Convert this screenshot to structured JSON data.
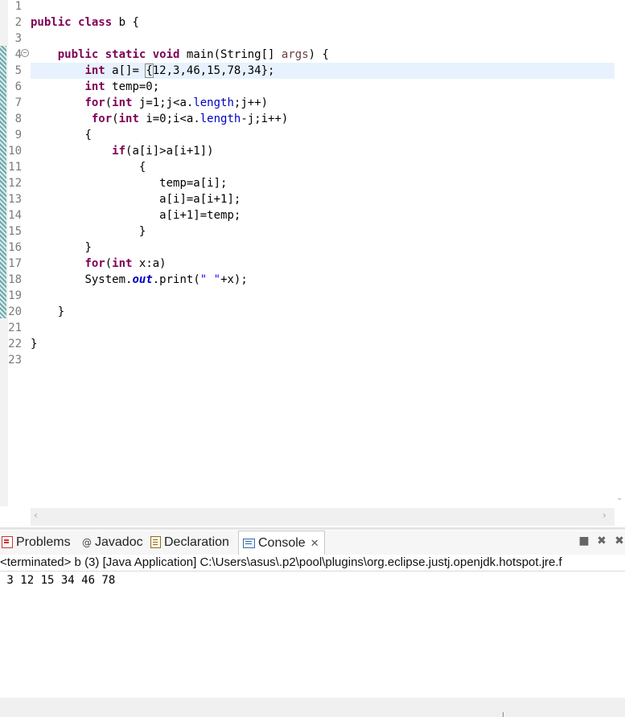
{
  "editor": {
    "line_numbers": [
      "1",
      "2",
      "3",
      "4",
      "5",
      "6",
      "7",
      "8",
      "9",
      "10",
      "11",
      "12",
      "13",
      "14",
      "15",
      "16",
      "17",
      "18",
      "19",
      "20",
      "21",
      "22",
      "23"
    ],
    "code": {
      "l2_kw1": "public",
      "l2_kw2": "class",
      "l2_rest": " b {",
      "l4_kw1": "public",
      "l4_kw2": "static",
      "l4_kw3": "void",
      "l4_t1": " main(String[] ",
      "l4_param": "args",
      "l4_t2": ") {",
      "l5_kw": "int",
      "l5_t1": " a[]= ",
      "l5_brace": "{",
      "l5_t2": "12,3,46,15,78,34};",
      "l6_kw": "int",
      "l6_t1": " temp=0;",
      "l7_kw1": "for",
      "l7_t1": "(",
      "l7_kw2": "int",
      "l7_t2": " j=1;j<a.",
      "l7_fld": "length",
      "l7_t3": ";j++)",
      "l8_kw1": "for",
      "l8_t1": "(",
      "l8_kw2": "int",
      "l8_t2": " i=0;i<a.",
      "l8_fld": "length",
      "l8_t3": "-j;i++)",
      "l9_t": "{",
      "l10_kw": "if",
      "l10_t": "(a[i]>a[i+1])",
      "l11_t": "{",
      "l12_t": "temp=a[i];",
      "l13_t": "a[i]=a[i+1];",
      "l14_t": "a[i+1]=temp;",
      "l15_t": "}",
      "l16_t": "}",
      "l17_kw1": "for",
      "l17_t1": "(",
      "l17_kw2": "int",
      "l17_t2": " x:a)",
      "l18_t1": "System.",
      "l18_sfld": "out",
      "l18_t2": ".print(",
      "l18_str": "\" \"",
      "l18_t3": "+x);",
      "l20_t": "}",
      "l22_t": "}"
    }
  },
  "bottom_panel": {
    "tabs": {
      "problems": "Problems",
      "javadoc": "Javadoc",
      "declaration": "Declaration",
      "console": "Console"
    },
    "console_close": "✕",
    "terminated": "<terminated> b (3) [Java Application] C:\\Users\\asus\\.p2\\pool\\plugins\\org.eclipse.justj.openjdk.hotspot.jre.f",
    "output": " 3 12 15 34 46 78"
  },
  "icons": {
    "javadoc_glyph": "@",
    "remove_launch": "■",
    "remove_all": "✖",
    "more": "✖"
  },
  "colors": {
    "keyword": "#7f0055",
    "field": "#0000c0",
    "string": "#2a00ff",
    "param": "#6a3e3e",
    "current_line": "#e8f2fe"
  }
}
